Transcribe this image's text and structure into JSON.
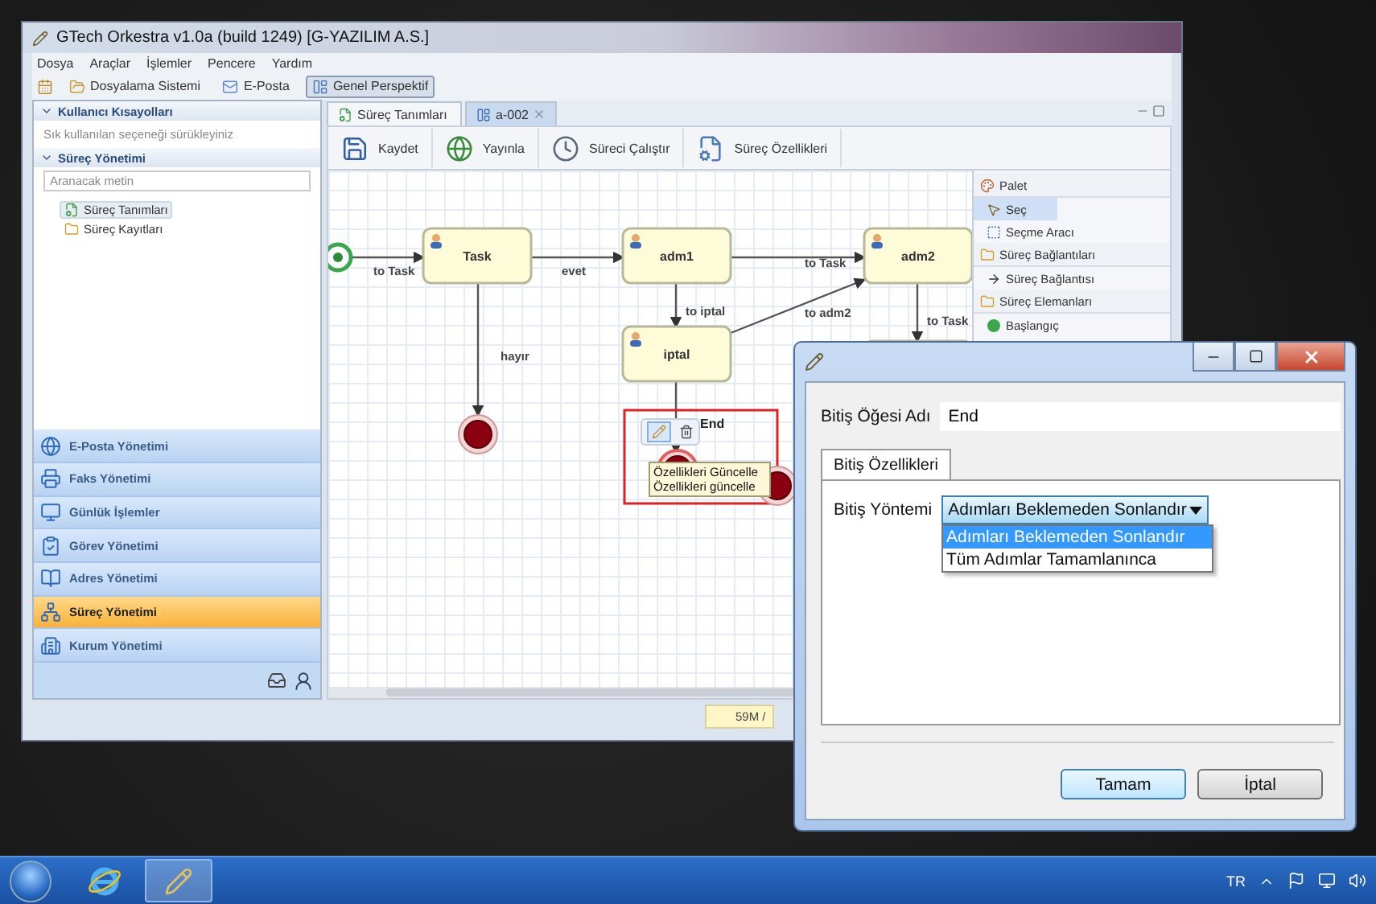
{
  "main_window": {
    "title": "GTech Orkestra v1.0a (build 1249) [G-YAZILIM A.S.]",
    "menu": [
      "Dosya",
      "Araçlar",
      "İşlemler",
      "Pencere",
      "Yardım"
    ],
    "toolbar": [
      {
        "label": "Dosyalama Sistemi",
        "kind": "folder",
        "pressed": false
      },
      {
        "label": "E-Posta",
        "kind": "mail",
        "pressed": false
      },
      {
        "label": "Genel Perspektif",
        "kind": "perspective",
        "pressed": true
      }
    ],
    "shortcuts": {
      "title": "Kullanıcı Kısayolları",
      "expanded": true,
      "hint": "Sık kullanılan seçeneği sürükleyiniz"
    },
    "process_panel": {
      "title": "Süreç Yönetimi",
      "expanded": true,
      "search": {
        "placeholder": "Aranacak metin"
      },
      "tree": [
        {
          "label": "Süreç Tanımları",
          "kind": "definitions",
          "selected": true
        },
        {
          "label": "Süreç Kayıtları",
          "kind": "records",
          "selected": false
        }
      ]
    },
    "nav": [
      {
        "label": "E-Posta Yönetimi",
        "kind": "mail",
        "selected": false
      },
      {
        "label": "Faks Yönetimi",
        "kind": "fax",
        "selected": false
      },
      {
        "label": "Günlük İşlemler",
        "kind": "daily",
        "selected": false
      },
      {
        "label": "Görev Yönetimi",
        "kind": "task",
        "selected": false
      },
      {
        "label": "Adres Yönetimi",
        "kind": "address",
        "selected": false
      },
      {
        "label": "Süreç Yönetimi",
        "kind": "process",
        "selected": true
      },
      {
        "label": "Kurum Yönetimi",
        "kind": "org",
        "selected": false
      }
    ],
    "editor": {
      "tabs": [
        {
          "label": "Süreç Tanımları",
          "selected": false
        },
        {
          "label": "a-002",
          "selected": true
        }
      ],
      "actions": [
        {
          "label": "Kaydet",
          "kind": "save"
        },
        {
          "label": "Yayınla",
          "kind": "publish"
        },
        {
          "label": "Süreci Çalıştır",
          "kind": "run"
        },
        {
          "label": "Süreç Özellikleri",
          "kind": "properties"
        }
      ],
      "diagram": {
        "nodes": [
          {
            "kind": "start",
            "selected": false
          },
          {
            "kind": "task",
            "label": "Task",
            "selected": false
          },
          {
            "kind": "task",
            "label": "adm1",
            "selected": false
          },
          {
            "kind": "task",
            "label": "adm2",
            "selected": false
          },
          {
            "kind": "task",
            "label": "iptal",
            "selected": false
          },
          {
            "kind": "end",
            "selected": false
          },
          {
            "kind": "end",
            "label": "End",
            "selected": true
          },
          {
            "kind": "end",
            "selected": false
          },
          {
            "kind": "task",
            "selected": false
          }
        ],
        "edges": [
          {
            "label": "to Task"
          },
          {
            "label": "evet"
          },
          {
            "label": "to Task"
          },
          {
            "label": "to iptal"
          },
          {
            "label": "to adm2"
          },
          {
            "label": "to Task"
          },
          {
            "label": "hayır"
          }
        ],
        "tooltip": {
          "title": "Özellikleri Güncelle",
          "text": "Özellikleri güncelle"
        }
      },
      "palette": {
        "title": "Palet",
        "tools": [
          {
            "label": "Seç",
            "kind": "select",
            "selected": true
          },
          {
            "label": "Seçme Aracı",
            "kind": "marquee",
            "selected": false
          }
        ],
        "groups": [
          {
            "title": "Süreç Bağlantıları",
            "items": [
              {
                "label": "Süreç Bağlantısı",
                "kind": "connection"
              }
            ]
          },
          {
            "title": "Süreç Elemanları",
            "items": [
              {
                "label": "Başlangıç",
                "kind": "start"
              }
            ]
          }
        ]
      }
    },
    "status_bar": {
      "memory": "59M /"
    }
  },
  "dialog": {
    "name_label": "Bitiş Öğesi Adı",
    "name_value": "End",
    "tabs": [
      {
        "label": "Bitiş Özellikleri",
        "selected": true
      }
    ],
    "method_label": "Bitiş Yöntemi",
    "method_value": "Adımları Beklemeden Sonlandır",
    "options": [
      {
        "label": "Adımları Beklemeden Sonlandır",
        "selected": true
      },
      {
        "label": "Tüm Adımlar Tamamlanınca",
        "selected": false
      }
    ],
    "buttons": [
      {
        "label": "Tamam",
        "default": true
      },
      {
        "label": "İptal",
        "default": false
      }
    ]
  },
  "taskbar": {
    "apps": [
      {
        "kind": "browser",
        "active": false
      },
      {
        "kind": "orkestra",
        "active": true
      }
    ],
    "language": "TR"
  }
}
